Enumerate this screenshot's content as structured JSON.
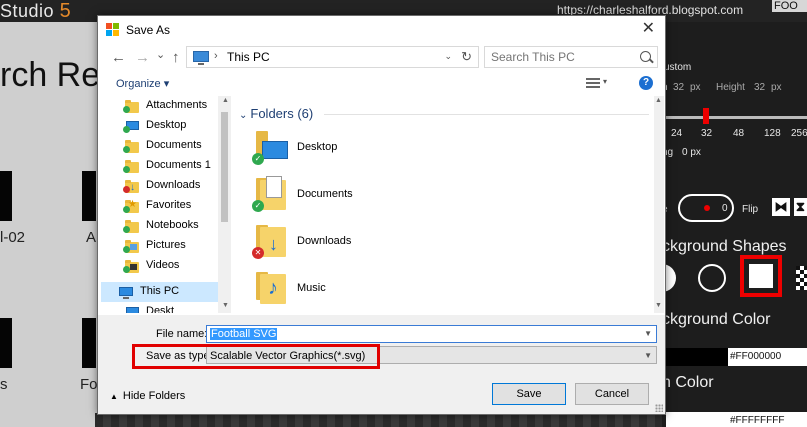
{
  "background_app": {
    "title_main": "Studio",
    "title_version": "5",
    "url": "https://charleshalford.blogspot.com",
    "corner_text": "FOO",
    "search_heading": "rch Re",
    "tile_labels": [
      "l-02",
      "A",
      "s",
      "Fo"
    ],
    "right_panel": {
      "custom_label": "ustom",
      "width_suffix": "n",
      "width_value": "32",
      "px": "px",
      "height_label": "Height",
      "height_value": "32",
      "sizes": [
        "24",
        "32",
        "48",
        "128",
        "256"
      ],
      "spacing_label": "ng",
      "spacing_value": "0 px",
      "rotate_suffix": "e",
      "rotate_value": "0",
      "flip_label": "Flip",
      "shapes_heading": "ckground Shapes",
      "bg_color_heading": "ckground Color",
      "bg_color_value": "#FF000000",
      "icon_color_heading": "n Color",
      "icon_color_value": "#FFFFFFFF"
    }
  },
  "dialog": {
    "title": "Save As",
    "close_glyph": "✕",
    "nav": {
      "back": "←",
      "forward": "→",
      "recent": "⌄",
      "up": "↑"
    },
    "address": {
      "chevron": "›",
      "location": "This PC",
      "dropdown": "⌄",
      "refresh": "↻"
    },
    "search": {
      "placeholder": "Search This PC"
    },
    "toolbar": {
      "organize": "Organize ▾",
      "help": "?"
    },
    "nav_items": [
      {
        "label": "Attachments",
        "icon": "folder-icon",
        "badge": "#2fa84f"
      },
      {
        "label": "Desktop",
        "icon": "desktop-icon",
        "badge": "#2fa84f"
      },
      {
        "label": "Documents",
        "icon": "folder-icon",
        "badge": "#2fa84f"
      },
      {
        "label": "Documents 1",
        "icon": "folder-icon",
        "badge": "#2fa84f"
      },
      {
        "label": "Downloads",
        "icon": "downloads-icon",
        "badge": "#d42b2b"
      },
      {
        "label": "Favorites",
        "icon": "folder-icon",
        "badge": "#2fa84f"
      },
      {
        "label": "Notebooks",
        "icon": "folder-icon",
        "badge": "#2fa84f"
      },
      {
        "label": "Pictures",
        "icon": "folder-icon",
        "badge": "#2fa84f"
      },
      {
        "label": "Videos",
        "icon": "folder-icon",
        "badge": "#2fa84f"
      },
      {
        "label": "This PC",
        "icon": "pc-icon",
        "selected": true
      },
      {
        "label": "Deskt",
        "icon": "desktop-icon"
      }
    ],
    "content": {
      "group_header": "Folders (6)",
      "folders": [
        {
          "name": "Desktop",
          "badge": "#2fa84f",
          "badge_glyph": "✓"
        },
        {
          "name": "Documents",
          "badge": "#2fa84f",
          "badge_glyph": "✓"
        },
        {
          "name": "Downloads",
          "badge": "#d42b2b",
          "badge_glyph": "✕"
        },
        {
          "name": "Music",
          "badge": "",
          "badge_glyph": ""
        }
      ]
    },
    "file_name_label": "File name:",
    "file_name_value": "Football SVG",
    "save_type_label": "Save as type:",
    "save_type_value": "Scalable Vector Graphics(*.svg)",
    "hide_folders": "Hide Folders",
    "save_button": "Save",
    "cancel_button": "Cancel"
  },
  "colors": {
    "highlight_red": "#e10000",
    "selection_blue": "#cce8ff",
    "accent_blue": "#0078d7"
  }
}
